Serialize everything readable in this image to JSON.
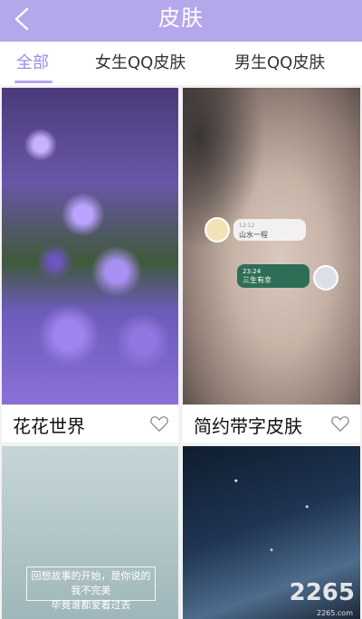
{
  "header": {
    "title": "皮肤",
    "back_icon": "chevron-left-icon"
  },
  "tabs": [
    {
      "label": "全部",
      "active": true
    },
    {
      "label": "女生QQ皮肤",
      "active": false
    },
    {
      "label": "男生QQ皮肤",
      "active": false
    }
  ],
  "cards": [
    {
      "title": "花花世界",
      "image": "purple flowers",
      "favorite_icon": "heart-icon"
    },
    {
      "title": "简约带字皮肤",
      "image": "portrait with chat bubbles",
      "favorite_icon": "heart-icon",
      "chat": [
        {
          "name": "山水一程",
          "time": "12:12"
        },
        {
          "time": "23:24",
          "text": "三生有幸"
        }
      ]
    },
    {
      "title": "",
      "image": "pale teal",
      "quote_lines": [
        "回想故事的开始，是你说的我不完美",
        "毕竟谁都爱着过去"
      ]
    },
    {
      "title": "",
      "image": "starry night sky"
    }
  ],
  "watermark": {
    "brand": "2265",
    "sub": "2265.com"
  },
  "colors": {
    "header": "#b4a7ea",
    "active_tab": "#9b8ee3"
  }
}
